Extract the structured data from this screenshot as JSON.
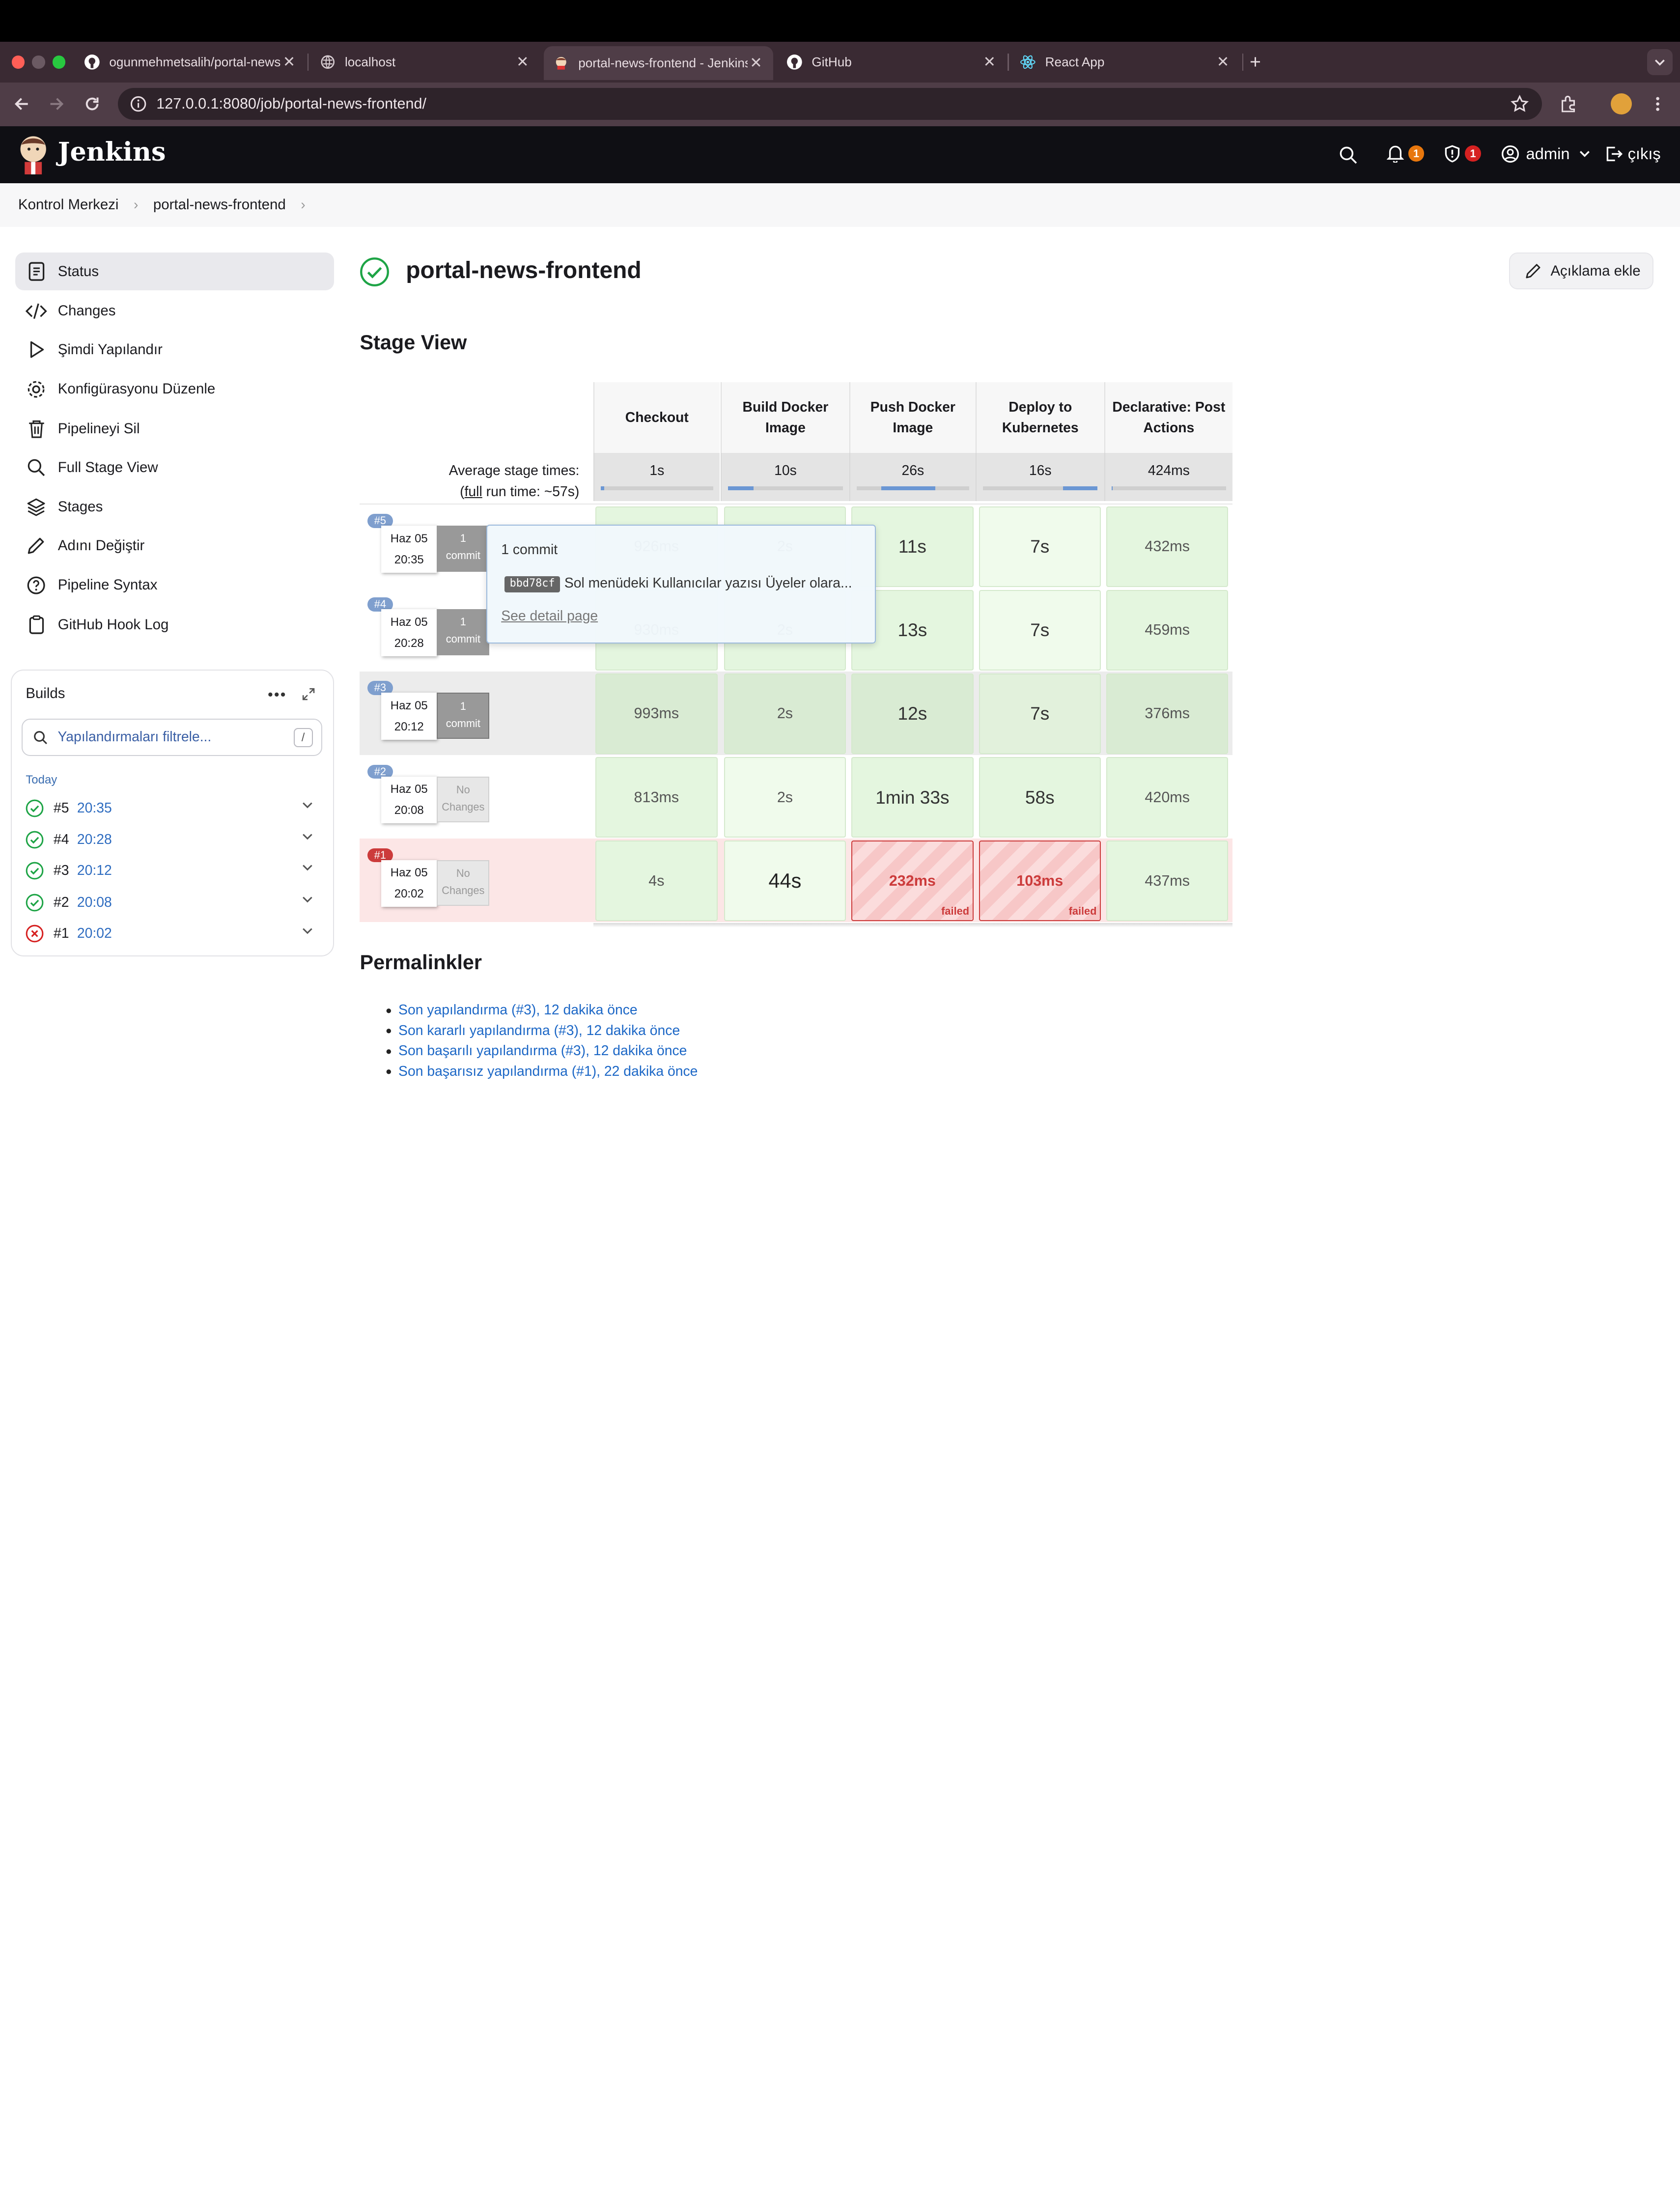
{
  "browser": {
    "tabs": [
      {
        "title": "ogunmehmetsalih/portal-news-frontend",
        "icon": "github-icon"
      },
      {
        "title": "localhost",
        "icon": "globe-icon"
      },
      {
        "title": "portal-news-frontend - Jenkins",
        "icon": "jenkins-icon",
        "active": true
      },
      {
        "title": "GitHub",
        "icon": "github-icon"
      },
      {
        "title": "React App",
        "icon": "react-icon"
      }
    ],
    "new_tab": "+",
    "url": "127.0.0.1:8080/job/portal-news-frontend/"
  },
  "header": {
    "brand": "Jenkins",
    "notifications_count": "1",
    "security_count": "1",
    "user": "admin",
    "logout": "çıkış",
    "colors": {
      "notification_badge": "#e8770d",
      "security_badge": "#d62121"
    }
  },
  "breadcrumb": [
    "Kontrol Merkezi",
    "portal-news-frontend"
  ],
  "sidebar": {
    "items": [
      {
        "label": "Status",
        "icon": "status-icon"
      },
      {
        "label": "Changes",
        "icon": "code-icon"
      },
      {
        "label": "Şimdi Yapılandır",
        "icon": "play-icon"
      },
      {
        "label": "Konfigürasyonu Düzenle",
        "icon": "gear-icon"
      },
      {
        "label": "Pipelineyi Sil",
        "icon": "trash-icon"
      },
      {
        "label": "Full Stage View",
        "icon": "search-icon"
      },
      {
        "label": "Stages",
        "icon": "layers-icon"
      },
      {
        "label": "Adını Değiştir",
        "icon": "pencil-icon"
      },
      {
        "label": "Pipeline Syntax",
        "icon": "help-icon"
      },
      {
        "label": "GitHub Hook Log",
        "icon": "clipboard-icon"
      }
    ]
  },
  "builds": {
    "title": "Builds",
    "filter_placeholder": "Yapılandırmaları filtrele...",
    "filter_shortcut": "/",
    "group_label": "Today",
    "list": [
      {
        "number": "#5",
        "time": "20:35",
        "status": "success"
      },
      {
        "number": "#4",
        "time": "20:28",
        "status": "success"
      },
      {
        "number": "#3",
        "time": "20:12",
        "status": "success"
      },
      {
        "number": "#2",
        "time": "20:08",
        "status": "success"
      },
      {
        "number": "#1",
        "time": "20:02",
        "status": "failed"
      }
    ]
  },
  "main": {
    "job_title": "portal-news-frontend",
    "add_description": "Açıklama ekle",
    "stage_view_title": "Stage View"
  },
  "stage_view": {
    "avg_label_line1": "Average stage times:",
    "avg_label_line2a": "(",
    "avg_label_full": "full",
    "avg_label_line2b": " run time: ~57s)",
    "stages": [
      {
        "name": "Checkout",
        "avg": "1s",
        "progress_start": 0,
        "progress": 0.03
      },
      {
        "name": "Build Docker Image",
        "avg": "10s",
        "progress_start": 0,
        "progress": 0.22
      },
      {
        "name": "Push Docker Image",
        "avg": "26s",
        "progress_start": 0.22,
        "progress": 0.48
      },
      {
        "name": "Deploy to Kubernetes",
        "avg": "16s",
        "progress_start": 0.7,
        "progress": 0.3
      },
      {
        "name": "Declarative: Post Actions",
        "avg": "424ms",
        "progress_start": 0,
        "progress": 0.01
      }
    ],
    "runs": [
      {
        "badge": "#5",
        "date": "Haz 05",
        "time": "20:35",
        "commit_count": "1",
        "commit_word": "commit",
        "has_commits": true,
        "cells": [
          {
            "v": "926ms"
          },
          {
            "v": "2s"
          },
          {
            "v": "11s"
          },
          {
            "v": "7s"
          },
          {
            "v": "432ms"
          }
        ]
      },
      {
        "badge": "#4",
        "date": "Haz 05",
        "time": "20:28",
        "commit_count": "1",
        "commit_word": "commit",
        "has_commits": true,
        "cells": [
          {
            "v": "930ms"
          },
          {
            "v": "2s"
          },
          {
            "v": "13s"
          },
          {
            "v": "7s"
          },
          {
            "v": "459ms"
          }
        ]
      },
      {
        "badge": "#3",
        "date": "Haz 05",
        "time": "20:12",
        "commit_count": "1",
        "commit_word": "commit",
        "has_commits": true,
        "cells": [
          {
            "v": "993ms"
          },
          {
            "v": "2s"
          },
          {
            "v": "12s"
          },
          {
            "v": "7s"
          },
          {
            "v": "376ms"
          }
        ]
      },
      {
        "badge": "#2",
        "date": "Haz 05",
        "time": "20:08",
        "commit_count": "No",
        "commit_word": "Changes",
        "has_commits": false,
        "cells": [
          {
            "v": "813ms"
          },
          {
            "v": "2s"
          },
          {
            "v": "1min 33s"
          },
          {
            "v": "58s"
          },
          {
            "v": "420ms"
          }
        ]
      },
      {
        "badge": "#1",
        "date": "Haz 05",
        "time": "20:02",
        "commit_count": "No",
        "commit_word": "Changes",
        "has_commits": false,
        "cells": [
          {
            "v": "4s"
          },
          {
            "v": "44s"
          },
          {
            "v": "232ms",
            "failed": true,
            "failed_label": "failed"
          },
          {
            "v": "103ms",
            "failed": true,
            "failed_label": "failed"
          },
          {
            "v": "437ms"
          }
        ]
      }
    ],
    "tooltip": {
      "title": "1 commit",
      "sha": "bbd78cf",
      "message": "Sol menüdeki Kullanıcılar yazısı Üyeler olara...",
      "link": "See detail page"
    }
  },
  "permalinks": {
    "title": "Permalinkler",
    "items": [
      "Son yapılandırma (#3), 12 dakika önce",
      "Son kararlı yapılandırma (#3), 12 dakika önce",
      "Son başarılı yapılandırma (#3), 12 dakika önce",
      "Son başarısız yapılandırma (#1), 22 dakika önce"
    ]
  }
}
